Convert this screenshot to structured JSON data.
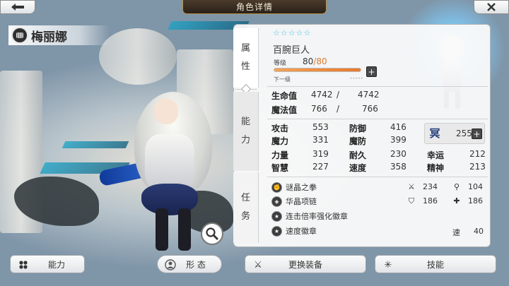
{
  "header": {
    "title": "角色详情"
  },
  "character": {
    "name": "梅丽娜"
  },
  "side_tabs": [
    {
      "label": "属\n性"
    },
    {
      "label": "能\n力"
    },
    {
      "label": "任\n务"
    }
  ],
  "attributes": {
    "rarity_stars": 5,
    "class": "百腕巨人",
    "level_label": "等级",
    "level": "80",
    "level_max": "80",
    "level_progress": 1.0,
    "next_label": "下一级",
    "next_value": "-----",
    "hp_label": "生命值",
    "hp": "4742",
    "hp_max": "4742",
    "mp_label": "魔法值",
    "mp": "766",
    "mp_max": "766",
    "slash": "/",
    "stats": [
      {
        "label": "攻击",
        "value": "553"
      },
      {
        "label": "防御",
        "value": "416"
      },
      {
        "label": "魔力",
        "value": "331"
      },
      {
        "label": "魔防",
        "value": "399"
      },
      {
        "label": "力量",
        "value": "319"
      },
      {
        "label": "耐久",
        "value": "230"
      },
      {
        "label": "幸运",
        "value": "212"
      },
      {
        "label": "智慧",
        "value": "227"
      },
      {
        "label": "速度",
        "value": "358"
      },
      {
        "label": "精神",
        "value": "213"
      }
    ],
    "rank_glyph": "冥",
    "rank_value": "255"
  },
  "equipment": [
    {
      "name": "谜晶之拳",
      "icon": "fist-emblem-icon"
    },
    {
      "name": "华晶项链",
      "icon": "necklace-emblem-icon"
    },
    {
      "name": "连击倍率强化徽章",
      "icon": "badge-icon"
    },
    {
      "name": "速度徽章",
      "icon": "badge-icon"
    }
  ],
  "equip_stats": {
    "sword": "234",
    "staff": "104",
    "shield": "186",
    "cross": "186",
    "speed_label": "速",
    "speed": "40"
  },
  "buttons": {
    "ability": "能力",
    "form": "形 态",
    "change_equip": "更换装备",
    "skills": "技能"
  },
  "colors": {
    "accent": "#e07a2a",
    "star": "#49bfe8",
    "title_bg": "#2b2119"
  }
}
